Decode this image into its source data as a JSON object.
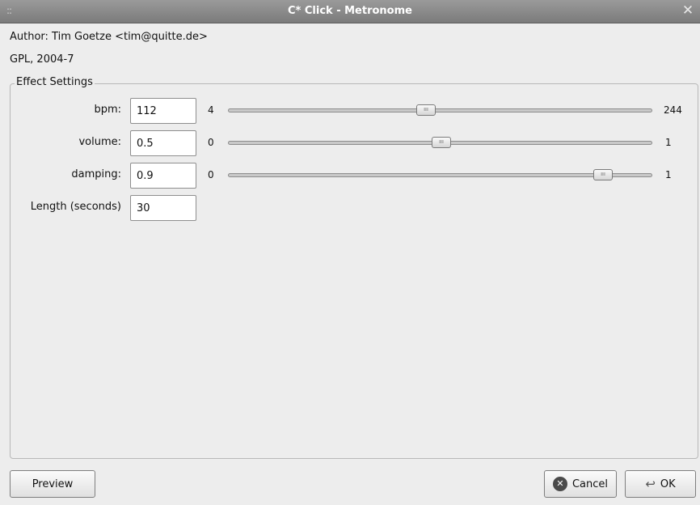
{
  "window": {
    "title": "C* Click - Metronome",
    "grip": "::",
    "close_glyph": "✕"
  },
  "info": {
    "author": "Author: Tim Goetze <tim@quitte.de>",
    "license": "GPL, 2004-7"
  },
  "effect_settings": {
    "label": "Effect Settings",
    "rows": [
      {
        "label": "bpm:",
        "value": "112",
        "min": "4",
        "max": "244",
        "slider_fraction": 0.463
      },
      {
        "label": "volume:",
        "value": "0.5",
        "min": "0",
        "max": "1",
        "slider_fraction": 0.5
      },
      {
        "label": "damping:",
        "value": "0.9",
        "min": "0",
        "max": "1",
        "slider_fraction": 0.9
      }
    ],
    "length": {
      "label": "Length (seconds)",
      "value": "30"
    }
  },
  "buttons": {
    "preview": "Preview",
    "cancel": "Cancel",
    "ok": "OK"
  },
  "icons": {
    "cancel": "cancel-icon",
    "ok": "ok-return-icon"
  }
}
